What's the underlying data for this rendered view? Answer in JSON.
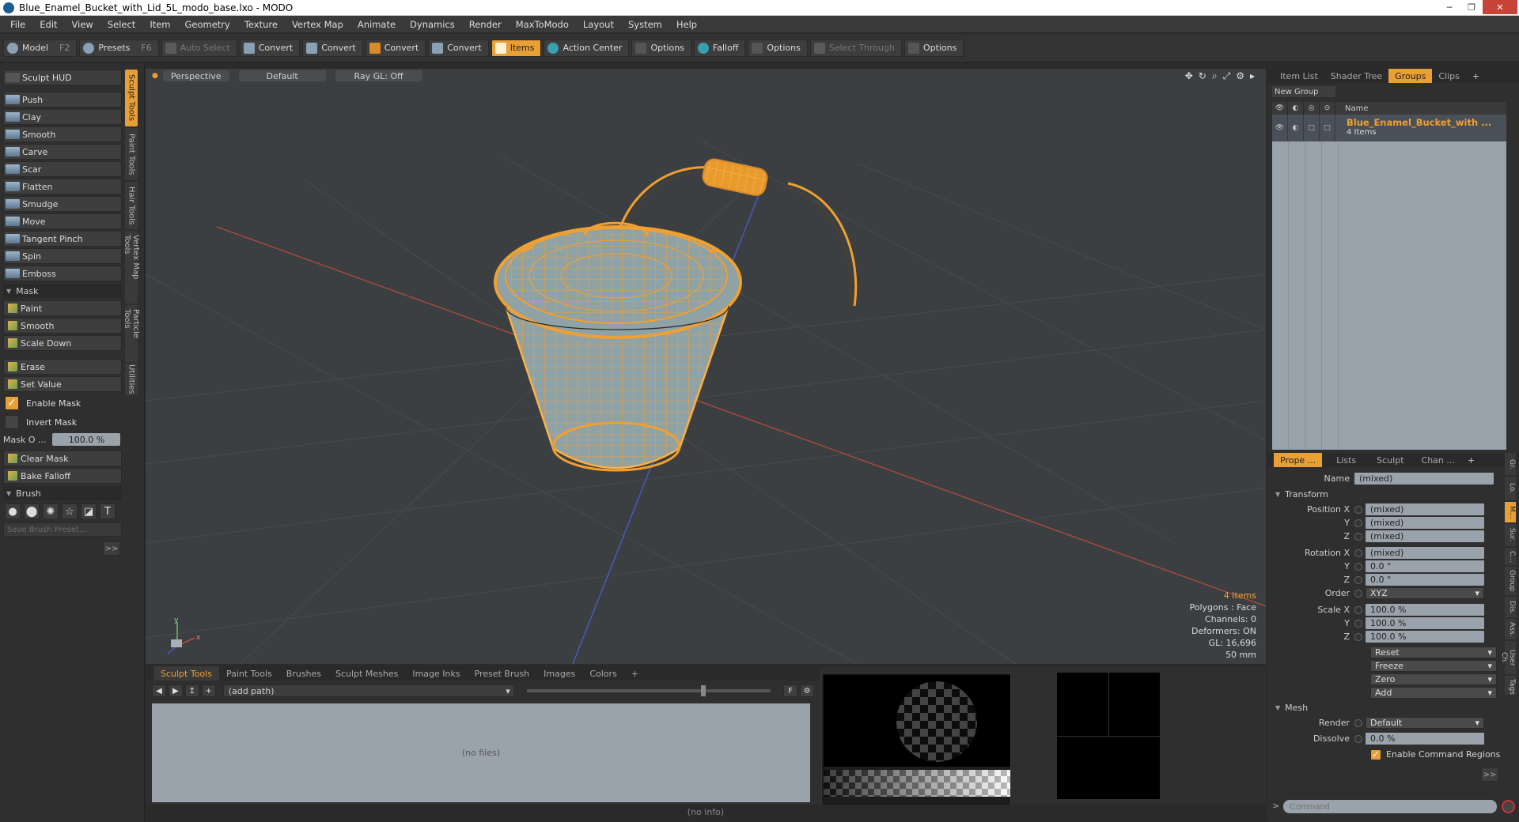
{
  "window": {
    "title": "Blue_Enamel_Bucket_with_Lid_5L_modo_base.lxo - MODO",
    "buttons": [
      "─",
      "❐",
      "✕"
    ]
  },
  "menu": [
    "File",
    "Edit",
    "View",
    "Select",
    "Item",
    "Geometry",
    "Texture",
    "Vertex Map",
    "Animate",
    "Dynamics",
    "Render",
    "MaxToModo",
    "Layout",
    "System",
    "Help"
  ],
  "toolbar": {
    "model": "Model",
    "model_key": "F2",
    "presets": "Presets",
    "presets_key": "F6",
    "auto_select": "Auto Select",
    "convert1": "Convert",
    "convert2": "Convert",
    "convert3": "Convert",
    "convert4": "Convert",
    "items": "Items",
    "action_center": "Action Center",
    "options1": "Options",
    "falloff": "Falloff",
    "options2": "Options",
    "select_through": "Select Through",
    "options3": "Options"
  },
  "sculpt": {
    "hud": "Sculpt HUD",
    "tools": [
      "Push",
      "Clay",
      "Smooth",
      "Carve",
      "Scar",
      "Flatten",
      "Smudge",
      "Move",
      "Tangent Pinch",
      "Spin",
      "Emboss"
    ],
    "mask_section": "Mask",
    "mask_tools": [
      "Paint",
      "Smooth",
      "Scale Down"
    ],
    "erase": "Erase",
    "set_value": "Set Value",
    "enable_mask": "Enable Mask",
    "invert_mask": "Invert Mask",
    "mask_opacity_label": "Mask O ...",
    "mask_opacity_value": "100.0 %",
    "clear_mask": "Clear Mask",
    "bake_falloff": "Bake Falloff",
    "brush_section": "Brush",
    "save_preset": "Save Brush Preset...",
    "more": ">>",
    "vtabs": [
      "Sculpt Tools",
      "Paint Tools",
      "Hair Tools",
      "Vertex Map Tools",
      "Particle Tools",
      "Utilities"
    ]
  },
  "viewport": {
    "view": "Perspective",
    "shading": "Default",
    "raygl": "Ray GL: Off",
    "stats": {
      "items": "4 Items",
      "polygons": "Polygons : Face",
      "channels": "Channels: 0",
      "deformers": "Deformers: ON",
      "gl": "GL: 16,696",
      "lens": "50 mm"
    }
  },
  "bottom": {
    "tabs": [
      "Sculpt Tools",
      "Paint Tools",
      "Brushes",
      "Sculpt Meshes",
      "Image Inks",
      "Preset Brush",
      "Images",
      "Colors",
      "+"
    ],
    "path": "(add path)",
    "no_files": "(no files)",
    "status": "(no info)"
  },
  "groups": {
    "tabs": [
      "Item List",
      "Shader Tree",
      "Groups",
      "Clips",
      "+"
    ],
    "new_group": "New Group",
    "name_col": "Name",
    "row_name": "Blue_Enamel_Bucket_with ...",
    "row_count": "4 Items"
  },
  "properties": {
    "tabs": [
      "Prope ...",
      "Lists",
      "Sculpt",
      "Chan ...",
      "+"
    ],
    "name_label": "Name",
    "name_value": "(mixed)",
    "transform": "Transform",
    "pos_label": "Position X",
    "pos_x": "(mixed)",
    "pos_y": "(mixed)",
    "pos_z": "(mixed)",
    "rot_label": "Rotation X",
    "rot_x": "(mixed)",
    "rot_y": "0.0 °",
    "rot_z": "0.0 °",
    "order_label": "Order",
    "order": "XYZ",
    "scale_label": "Scale X",
    "scale_x": "100.0 %",
    "scale_y": "100.0 %",
    "scale_z": "100.0 %",
    "y": "Y",
    "z": "Z",
    "reset": "Reset",
    "freeze": "Freeze",
    "zero": "Zero",
    "add": "Add",
    "mesh": "Mesh",
    "render_label": "Render",
    "render": "Default",
    "dissolve_label": "Dissolve",
    "dissolve": "0.0 %",
    "enable_cmd": "Enable Command Regions",
    "more": ">>",
    "vtabs": [
      "Gr.",
      "Lo.",
      "M...",
      "Sur.",
      "C...",
      "Group",
      "Dis.",
      "Ass.",
      "User Ch.",
      "Tags"
    ]
  },
  "command": {
    "prompt": ">",
    "placeholder": "Command"
  },
  "colors": {
    "accent": "#e8a036",
    "wire": "#f0a030"
  }
}
